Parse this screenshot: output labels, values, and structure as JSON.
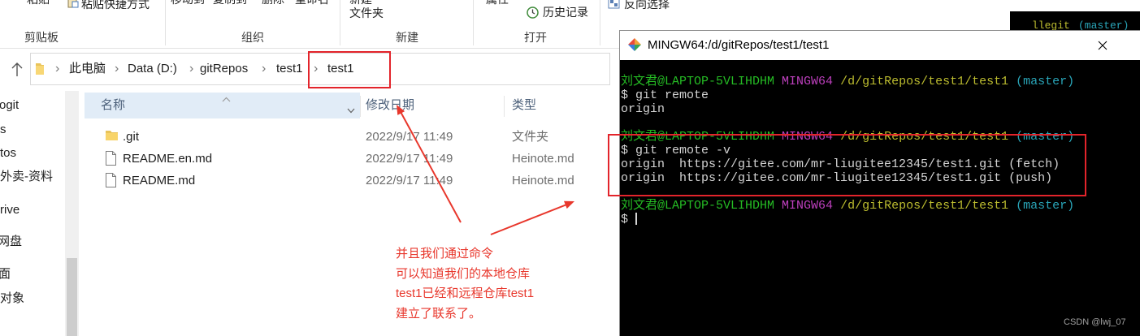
{
  "explorer": {
    "ribbon": {
      "paste_label": "粘贴",
      "paste_shortcut_label": "粘贴快捷方式",
      "move_to_label": "移动到",
      "copy_to_label": "复制到",
      "delete_label": "删除",
      "rename_label": "重命名",
      "new_folder_line1": "新建",
      "new_folder_line2": "文件夹",
      "properties_label": "属性",
      "history_label": "历史记录",
      "invert_selection_label": "反向选择",
      "groups": [
        "剪贴板",
        "组织",
        "新建",
        "打开"
      ]
    },
    "address_bar": {
      "separator": "›",
      "breadcrumb": [
        "此电脑",
        "Data (D:)",
        "gitRepos",
        "test1",
        "test1"
      ]
    },
    "nav_pane": {
      "items": [
        "ogit",
        "s",
        "tos",
        "外卖-资料",
        "rive",
        "网盘",
        "面",
        "对象"
      ]
    },
    "file_list": {
      "columns": {
        "name": "名称",
        "modified": "修改日期",
        "type": "类型"
      },
      "rows": [
        {
          "icon": "folder-icon",
          "name": ".git",
          "modified": "2022/9/17 11:49",
          "type": "文件夹"
        },
        {
          "icon": "file-icon",
          "name": "README.en.md",
          "modified": "2022/9/17 11:49",
          "type": "Heinote.md"
        },
        {
          "icon": "file-icon",
          "name": "README.md",
          "modified": "2022/9/17 11:49",
          "type": "Heinote.md"
        }
      ]
    }
  },
  "annotation": {
    "lines": [
      "并且我们通过命令",
      "可以知道我们的本地仓库",
      "test1已经和远程仓库test1",
      "建立了联系了。"
    ]
  },
  "terminal": {
    "title": "MINGW64:/d/gitRepos/test1/test1",
    "prompt": {
      "user_host": "刘文君@LAPTOP-5VLIHDHM",
      "env": "MINGW64",
      "cwd": "/d/gitRepos/test1/test1",
      "branch": "(master)"
    },
    "commands": [
      {
        "input": "$ git remote",
        "output": [
          "origin"
        ]
      },
      {
        "input": "$ git remote -v",
        "output": [
          "origin  https://gitee.com/mr-liugitee12345/test1.git (fetch)",
          "origin  https://gitee.com/mr-liugitee12345/test1.git (push)"
        ]
      },
      {
        "input": "$",
        "output": []
      }
    ]
  },
  "background_terminal": {
    "cwd_fragment": "llegit",
    "branch": "(master)"
  },
  "watermark": "CSDN @lwj_07",
  "colors": {
    "annotation_red": "#e8372c",
    "highlight_red": "#e3242b",
    "terminal_bg": "#000000",
    "terminal_fg": "#d4d4d4",
    "prompt_user": "#25bc24",
    "prompt_env": "#bc3fbc",
    "prompt_cwd": "#bcbc2f",
    "prompt_branch": "#29a5b8",
    "header_hover": "#e1ecf7",
    "folder_yellow": "#f8d46a"
  }
}
